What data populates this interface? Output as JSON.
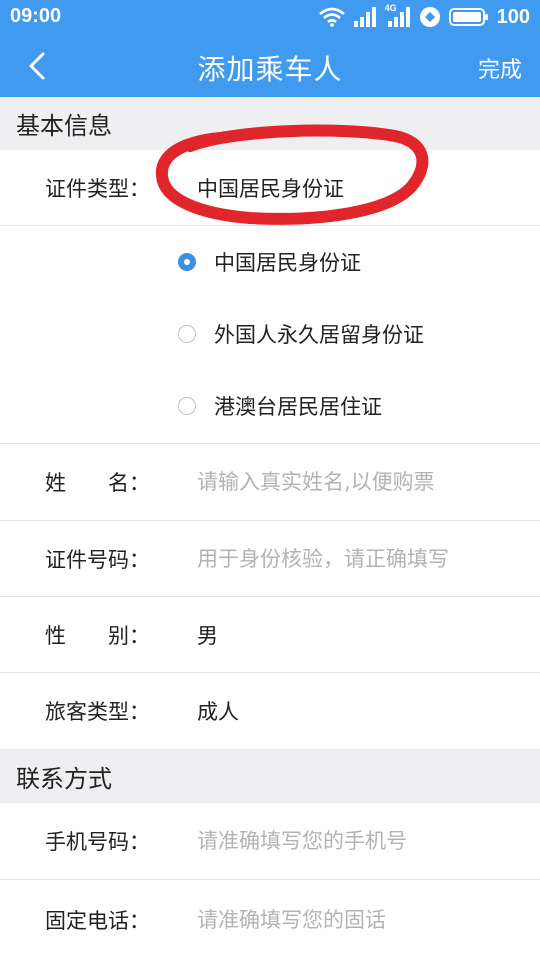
{
  "status_bar": {
    "time": "09:00",
    "battery": "100",
    "network_label": "4G",
    "icons": [
      "wifi-icon",
      "signal-icon",
      "signal-4g-icon",
      "data-saver-icon",
      "battery-icon"
    ]
  },
  "nav": {
    "title": "添加乘车人",
    "done_label": "完成",
    "back_icon": "chevron-left-icon"
  },
  "basic_info": {
    "section_title": "基本信息",
    "id_type": {
      "label": "证件类型：",
      "value": "中国居民身份证",
      "options": [
        {
          "label": "中国居民身份证",
          "selected": true
        },
        {
          "label": "外国人永久居留身份证",
          "selected": false
        },
        {
          "label": "港澳台居民居住证",
          "selected": false
        }
      ]
    },
    "name": {
      "label": "姓　　名：",
      "placeholder": "请输入真实姓名,以便购票"
    },
    "id_number": {
      "label": "证件号码：",
      "placeholder": "用于身份核验，请正确填写"
    },
    "gender": {
      "label": "性　　别：",
      "value": "男"
    },
    "passenger_type": {
      "label": "旅客类型：",
      "value": "成人"
    }
  },
  "contact": {
    "section_title": "联系方式",
    "mobile": {
      "label": "手机号码：",
      "placeholder": "请准确填写您的手机号"
    },
    "landline": {
      "label": "固定电话：",
      "placeholder": "请准确填写您的固话"
    }
  },
  "colors": {
    "brand": "#3f9af0",
    "annotation": "#e0262a",
    "section_bg": "#efeff2",
    "placeholder": "#b3b3b3"
  }
}
